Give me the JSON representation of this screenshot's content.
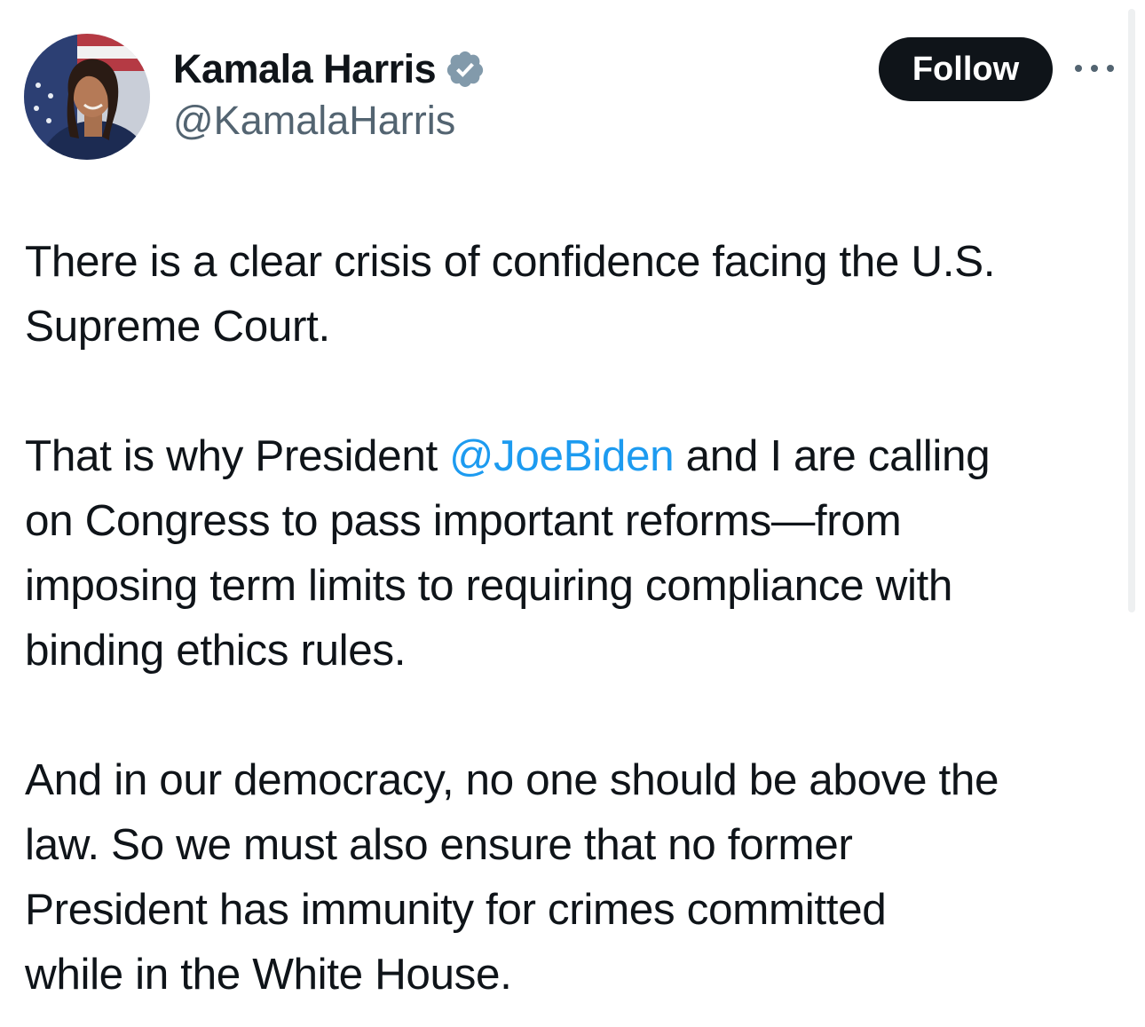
{
  "author": {
    "display_name": "Kamala Harris",
    "handle": "@KamalaHarris",
    "verified": true
  },
  "actions": {
    "follow_label": "Follow"
  },
  "tweet": {
    "p1": {
      "line1": "There is a clear crisis of confidence facing the U.S.",
      "line2": "Supreme Court."
    },
    "p2": {
      "line1_before": "That is why President ",
      "mention": "@JoeBiden",
      "line1_after": " and I are calling",
      "line2": "on Congress to pass important reforms—from",
      "line3": "imposing term limits to requiring compliance with",
      "line4": "binding ethics rules."
    },
    "p3": {
      "line1": "And in our democracy, no one should be above the",
      "line2": "law. So we must also ensure that no former",
      "line3": "President has immunity for crimes committed",
      "line4": "while in the White House."
    }
  },
  "colors": {
    "text": "#0f1419",
    "secondary": "#536471",
    "link": "#1d9bf0",
    "badge": "#829aab",
    "button_bg": "#0f1419"
  },
  "icons": {
    "verified": "verified-badge-icon",
    "more": "more-options-icon"
  }
}
